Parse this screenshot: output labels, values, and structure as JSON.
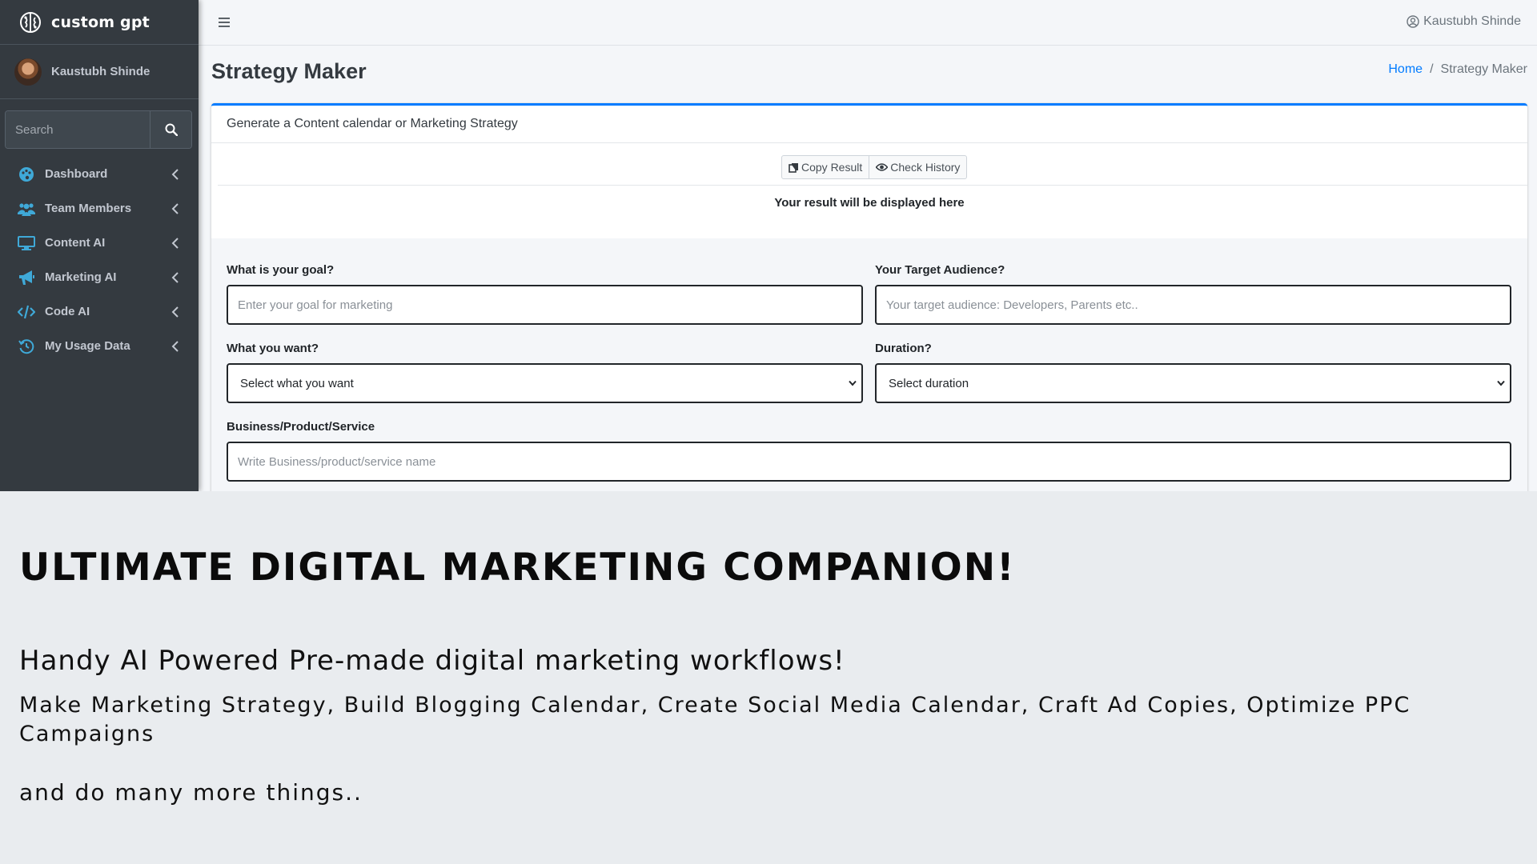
{
  "brand": {
    "name": "custom gpt"
  },
  "sidebar": {
    "user_name": "Kaustubh Shinde",
    "search_placeholder": "Search",
    "items": [
      {
        "label": "Dashboard",
        "icon": "palette-icon"
      },
      {
        "label": "Team Members",
        "icon": "users-icon"
      },
      {
        "label": "Content AI",
        "icon": "desktop-icon"
      },
      {
        "label": "Marketing AI",
        "icon": "bullhorn-icon"
      },
      {
        "label": "Code AI",
        "icon": "code-icon"
      },
      {
        "label": "My Usage Data",
        "icon": "history-icon"
      }
    ]
  },
  "header": {
    "user_name": "Kaustubh Shinde"
  },
  "page": {
    "title": "Strategy Maker",
    "breadcrumb": {
      "home": "Home",
      "separator": "/",
      "current": "Strategy Maker"
    }
  },
  "card": {
    "header": "Generate a Content calendar or Marketing Strategy",
    "copy_button": "Copy Result",
    "history_button": "Check History",
    "result_placeholder": "Your result will be displayed here"
  },
  "form": {
    "goal": {
      "label": "What is your goal?",
      "placeholder": "Enter your goal for marketing"
    },
    "audience": {
      "label": "Your Target Audience?",
      "placeholder": "Your target audience: Developers, Parents etc.."
    },
    "want": {
      "label": "What you want?",
      "selected": "Select what you want"
    },
    "duration": {
      "label": "Duration?",
      "selected": "Select duration"
    },
    "business": {
      "label": "Business/Product/Service",
      "placeholder": "Write Business/product/service name"
    }
  },
  "promo": {
    "headline": "ULTIMATE DIGITAL MARKETING COMPANION!",
    "subheadline": "Handy AI Powered Pre-made digital marketing workflows!",
    "body": "Make Marketing Strategy, Build Blogging Calendar, Create Social Media Calendar, Craft Ad Copies, Optimize PPC Campaigns",
    "more": "and do many more things.."
  },
  "colors": {
    "sidebar_bg": "#343a40",
    "accent": "#007bff",
    "icon_teal": "#3fa9d8",
    "content_bg": "#f4f6f9",
    "promo_bg": "#e9ecef"
  }
}
